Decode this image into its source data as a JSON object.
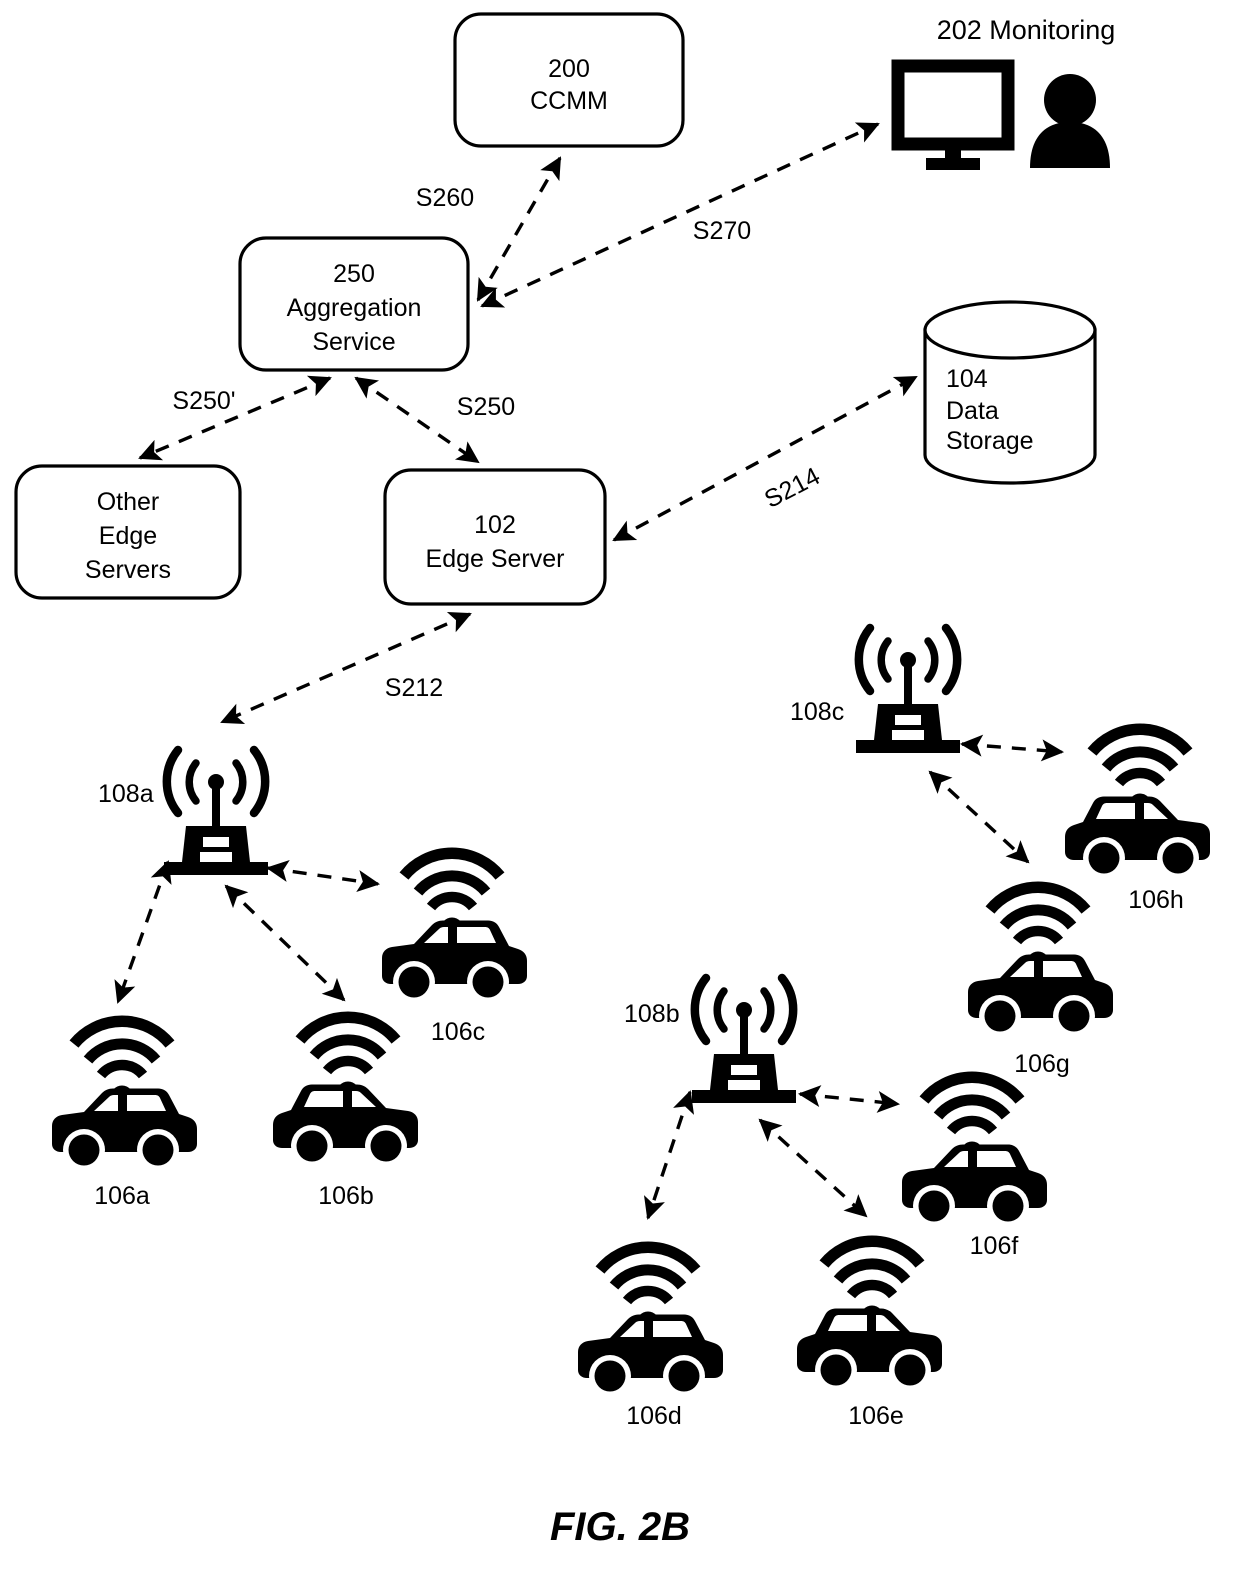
{
  "figure": {
    "caption": "FIG. 2B",
    "type": "patent-network-architecture-diagram"
  },
  "nodes": {
    "ccmm": {
      "ref": "200",
      "name": "CCMM",
      "shape": "rounded-rect"
    },
    "aggregation": {
      "ref": "250",
      "name": "Aggregation Service",
      "shape": "rounded-rect"
    },
    "other_edge": {
      "ref": "",
      "name": "Other Edge Servers",
      "shape": "rounded-rect"
    },
    "edge_server": {
      "ref": "102",
      "name": "Edge Server",
      "shape": "rounded-rect"
    },
    "data_storage": {
      "ref": "104",
      "name": "Data Storage",
      "shape": "cylinder"
    },
    "monitoring": {
      "ref": "202",
      "name": "Monitoring",
      "shape": "monitor-and-person"
    }
  },
  "labels": {
    "ccmm_line1": "200",
    "ccmm_line2": "CCMM",
    "aggregation_line1": "250",
    "aggregation_line2": "Aggregation",
    "aggregation_line3": "Service",
    "other_edge_line1": "Other",
    "other_edge_line2": "Edge",
    "other_edge_line3": "Servers",
    "edge_server_line1": "102",
    "edge_server_line2": "Edge Server",
    "data_storage_line1": "104",
    "data_storage_line2": "Data",
    "data_storage_line3": "Storage",
    "monitoring_title": "202 Monitoring"
  },
  "flows": [
    {
      "id": "S260",
      "label": "S260",
      "from": "aggregation",
      "to": "ccmm",
      "style": "dashed-double-arrow"
    },
    {
      "id": "S270",
      "label": "S270",
      "from": "aggregation",
      "to": "monitoring",
      "style": "dashed-double-arrow"
    },
    {
      "id": "S250p",
      "label": "S250'",
      "from": "aggregation",
      "to": "other_edge",
      "style": "dashed-double-arrow"
    },
    {
      "id": "S250",
      "label": "S250",
      "from": "aggregation",
      "to": "edge_server",
      "style": "dashed-double-arrow"
    },
    {
      "id": "S214",
      "label": "S214",
      "from": "edge_server",
      "to": "data_storage",
      "style": "dashed-double-arrow"
    },
    {
      "id": "S212",
      "label": "S212",
      "from": "edge_server",
      "to": "rsu_108a",
      "style": "dashed-double-arrow"
    }
  ],
  "rsus": [
    {
      "id": "rsu_108a",
      "label": "108a",
      "label_side": "left"
    },
    {
      "id": "rsu_108b",
      "label": "108b",
      "label_side": "left"
    },
    {
      "id": "rsu_108c",
      "label": "108c",
      "label_side": "left"
    }
  ],
  "vehicles": [
    {
      "id": "106a",
      "label": "106a",
      "rsu": "rsu_108a",
      "facing": "left"
    },
    {
      "id": "106b",
      "label": "106b",
      "rsu": "rsu_108a",
      "facing": "right"
    },
    {
      "id": "106c",
      "label": "106c",
      "rsu": "rsu_108a",
      "facing": "left"
    },
    {
      "id": "106d",
      "label": "106d",
      "rsu": "rsu_108b",
      "facing": "left"
    },
    {
      "id": "106e",
      "label": "106e",
      "rsu": "rsu_108b",
      "facing": "right"
    },
    {
      "id": "106f",
      "label": "106f",
      "rsu": "rsu_108b",
      "facing": "left"
    },
    {
      "id": "106g",
      "label": "106g",
      "rsu": "rsu_108c",
      "facing": "left"
    },
    {
      "id": "106h",
      "label": "106h",
      "rsu": "rsu_108c",
      "facing": "right"
    }
  ],
  "icons": {
    "antenna": "radio-tower-icon",
    "vehicle": "car-icon",
    "wifi": "wifi-signal-icon",
    "monitor": "desktop-monitor-icon",
    "person": "user-person-icon",
    "cylinder": "database-cylinder-icon"
  },
  "colors": {
    "stroke": "#000000",
    "fill": "#FFFFFF",
    "icon": "#000000",
    "background": "#FFFFFF"
  }
}
